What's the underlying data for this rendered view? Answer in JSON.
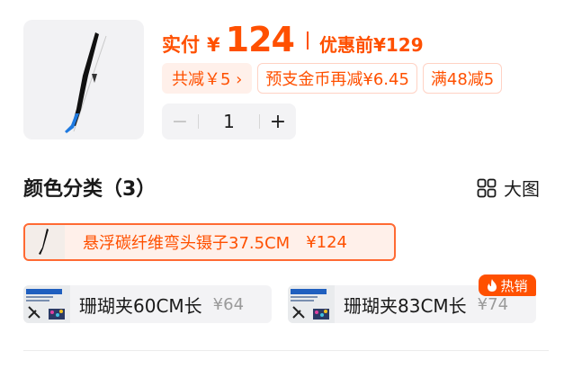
{
  "product": {
    "image": "tweezers-product-photo"
  },
  "price": {
    "prefix": "实付",
    "currency": "¥",
    "value": "124",
    "before_label": "优惠前",
    "before_value": "¥129"
  },
  "promos": [
    {
      "label": "共减￥5 ›",
      "style": "primary"
    },
    {
      "label": "预支金币再减¥6.45",
      "style": "outline"
    },
    {
      "label": "满48减5",
      "style": "outline"
    }
  ],
  "quantity": {
    "minus": "−",
    "value": "1",
    "plus": "+"
  },
  "variant_section": {
    "title": "颜色分类（3）",
    "view_toggle_label": "大图",
    "view_toggle_icon": "grid-icon"
  },
  "variants": [
    {
      "label": "悬浮碳纤维弯头镊子37.5CM",
      "price": "¥124",
      "selected": true
    },
    {
      "label": "珊瑚夹60CM长",
      "price": "¥64",
      "selected": false
    },
    {
      "label": "珊瑚夹83CM长",
      "price": "¥74",
      "selected": false,
      "badge": "热销"
    }
  ],
  "colors": {
    "accent": "#ff5000",
    "accent_bg": "#fff0ea",
    "muted_bg": "#f3f3f5"
  }
}
